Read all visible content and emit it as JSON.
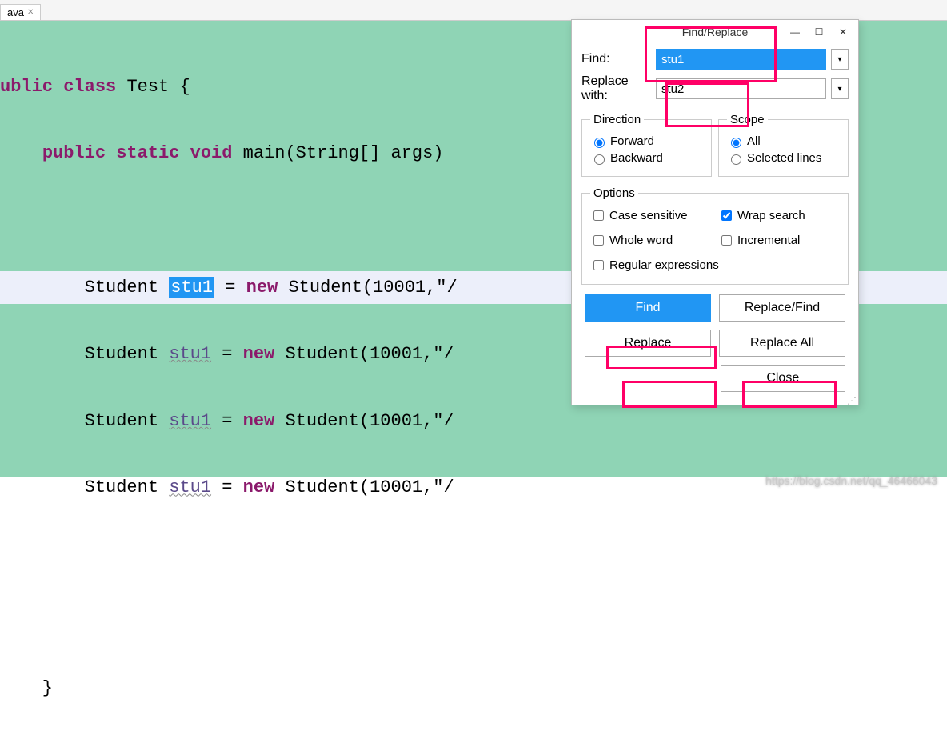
{
  "tab": {
    "label": "ava",
    "close_glyph": "✕"
  },
  "code": {
    "l1_kw1": "ublic",
    "l1_kw2": "class",
    "l1_cls": "Test",
    "l1_brace": "{",
    "l2_kw1": "public",
    "l2_kw2": "static",
    "l2_kw3": "void",
    "l2_name": "main(String[] args)",
    "l3_pre": "        Student ",
    "l3_var": "stu1",
    "l3_eq": " = ",
    "l3_new": "new",
    "l3_rest": " Student(10001,\"/",
    "l4_pre": "        Student ",
    "l4_var": "stu1",
    "l4_eq": " = ",
    "l4_new": "new",
    "l4_rest": " Student(10001,\"/",
    "l5_pre": "        Student ",
    "l5_var": "stu1",
    "l5_eq": " = ",
    "l5_new": "new",
    "l5_rest": " Student(10001,\"/",
    "l6_pre": "        Student ",
    "l6_var": "stu1",
    "l6_eq": " = ",
    "l6_new": "new",
    "l6_rest": " Student(10001,\"/",
    "l7_brace": "    }"
  },
  "dialog": {
    "title": "Find/Replace",
    "minimize": "—",
    "maximize": "☐",
    "close_x": "✕",
    "find_label": "Find:",
    "find_value": "stu1",
    "replace_label": "Replace with:",
    "replace_value": "stu2",
    "direction": {
      "legend": "Direction",
      "forward": "Forward",
      "backward": "Backward"
    },
    "scope": {
      "legend": "Scope",
      "all": "All",
      "selected": "Selected lines"
    },
    "options": {
      "legend": "Options",
      "case": "Case sensitive",
      "wrap": "Wrap search",
      "whole": "Whole word",
      "incremental": "Incremental",
      "regex": "Regular expressions"
    },
    "buttons": {
      "find": "Find",
      "replace_find": "Replace/Find",
      "replace": "Replace",
      "replace_all": "Replace All",
      "close": "Close"
    }
  },
  "watermark": "https://blog.csdn.net/qq_46466043"
}
